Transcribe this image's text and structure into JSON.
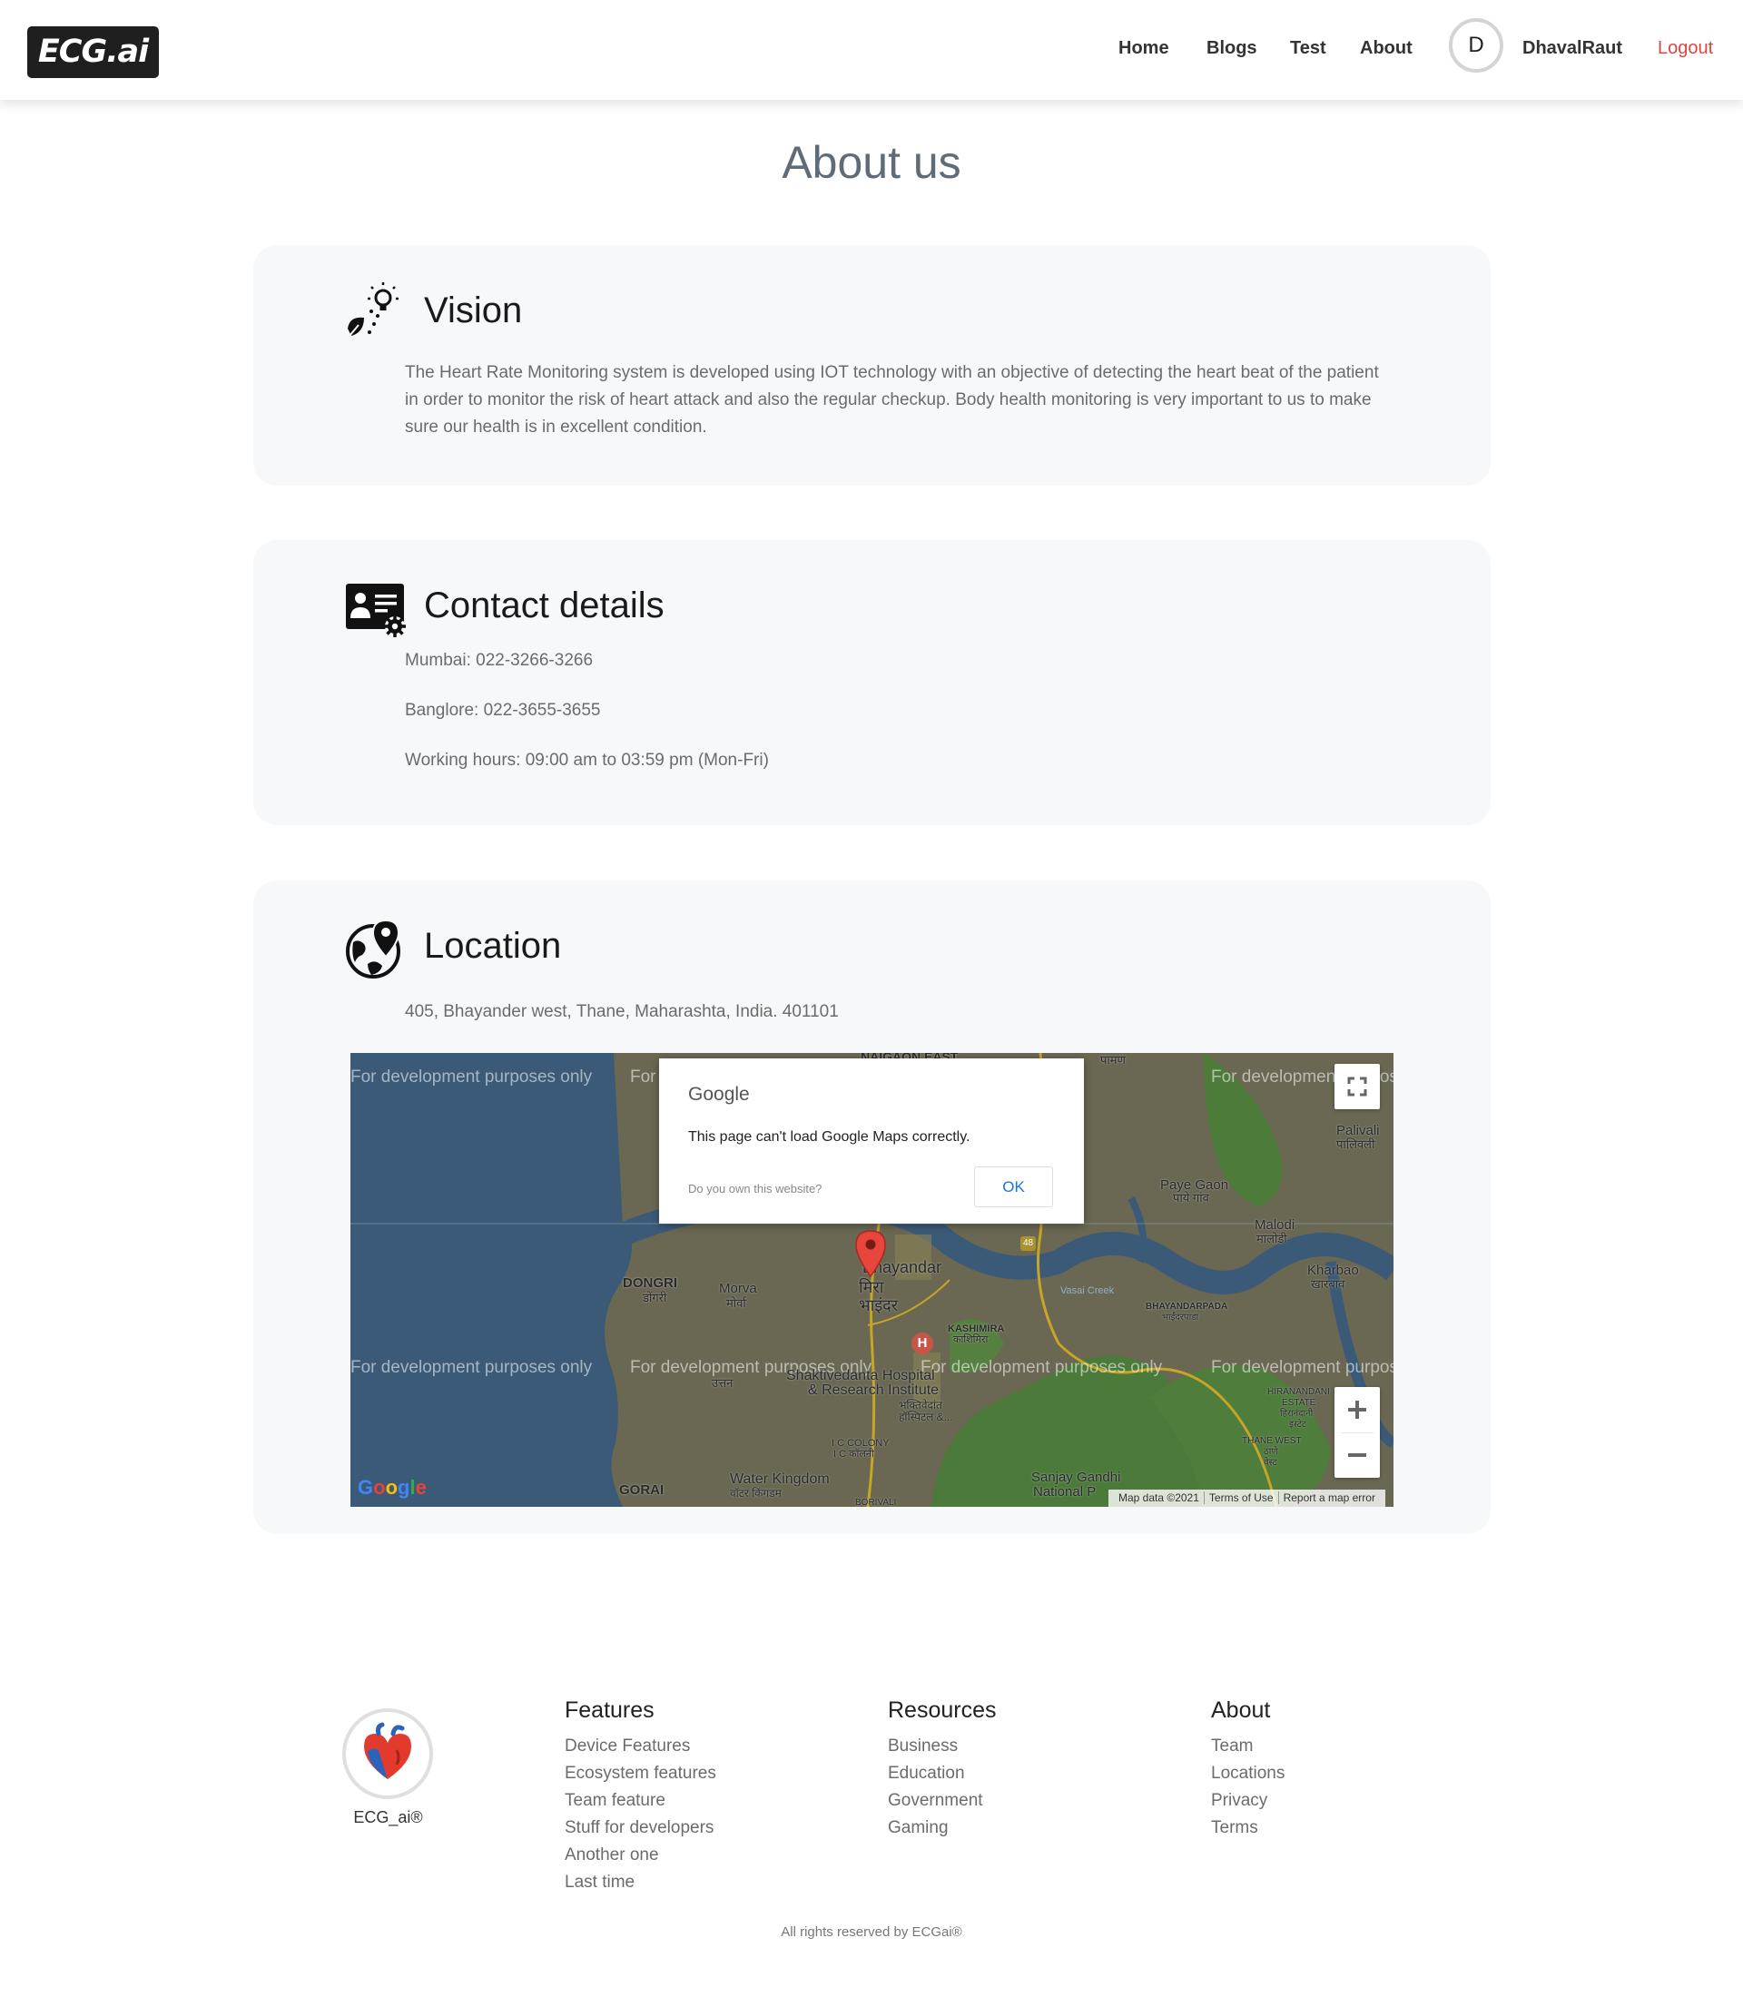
{
  "navbar": {
    "brand": "ECG.ai",
    "links": [
      "Home",
      "Blogs",
      "Test",
      "About"
    ],
    "avatar_initial": "D",
    "username": "DhavalRaut",
    "logout": "Logout"
  },
  "page": {
    "title": "About us"
  },
  "vision": {
    "title": "Vision",
    "text": "The Heart Rate Monitoring system is developed using IOT technology with an objective of detecting the heart beat of the patient in order to monitor the risk of heart attack and also the regular checkup. Body health monitoring is very important to us to make sure our health is in excellent condition."
  },
  "contact": {
    "title": "Contact details",
    "lines": [
      "Mumbai: 022-3266-3266",
      "Banglore: 022-3655-3655",
      "Working hours: 09:00 am to 03:59 pm (Mon-Fri)"
    ]
  },
  "location": {
    "title": "Location",
    "address": "405, Bhayander west, Thane, Maharashta, India. 401101",
    "map": {
      "watermark": "For development purposes only",
      "dialog": {
        "brand": "Google",
        "message": "This page can't load Google Maps correctly.",
        "own_link": "Do you own this website?",
        "ok": "OK"
      },
      "places": {
        "bhayandar": "Bhayandar",
        "bhayandar_local": "मिरा भाइंदर",
        "dongri": "DONGRI",
        "dongri_local": "डोंगरी",
        "morva": "Morva",
        "morva_local": "मोर्वा",
        "uttan_local": "उत्तन",
        "kashimira": "KASHIMIRA",
        "kashimira_local": "काशिमिरा",
        "hospital": "Shaktivedanta Hospital",
        "hospital2": "& Research Institute",
        "hospital_local": "भक्तिवेदांत",
        "hospital_local2": "हॉस्पिटल &...",
        "ic_colony": "I C COLONY",
        "ic_colony_local": "I C कॉलनी",
        "gorai": "GORAI",
        "water_kingdom": "Water Kingdom",
        "water_kingdom_local": "वॉटर किंगडम",
        "borivali": "BORIVALI",
        "sanjay": "Sanjay Gandhi",
        "national": "National P",
        "paye_gaon": "Paye Gaon",
        "paye_gaon_local": "पाये गांव",
        "malodi": "Malodi",
        "malodi_local": "मालोडी",
        "kharbao": "Kharbao",
        "kharbao_local": "खारबाव",
        "palivali": "Palivali",
        "palivali_local": "पालिवली",
        "bhayandarpada": "BHAYANDARPADA",
        "bhayandarpada_local": "भाईंदरपाडा",
        "hiranandani": "HIRANANDANI",
        "estate": "ESTATE",
        "hiranandani_local": "हिरानंदानी",
        "estate_local": "इस्टेट",
        "thane_west": "THANE WEST",
        "thane_local": "ठाणे",
        "west_local": "वेस्ट",
        "naigaon": "NAIGAON EAST",
        "paman": "पामण",
        "vasai_creek": "Vasai Creek",
        "road_48": "48",
        "hospital_marker": "H"
      },
      "logo": "Google",
      "footer": [
        "Map data ©2021",
        "Terms of Use",
        "Report a map error"
      ]
    }
  },
  "footer": {
    "brand": "ECG_ai®",
    "columns": [
      {
        "title": "Features",
        "links": [
          "Device Features",
          "Ecosystem features",
          "Team feature",
          "Stuff for developers",
          "Another one",
          "Last time"
        ]
      },
      {
        "title": "Resources",
        "links": [
          "Business",
          "Education",
          "Government",
          "Gaming"
        ]
      },
      {
        "title": "About",
        "links": [
          "Team",
          "Locations",
          "Privacy",
          "Terms"
        ]
      }
    ],
    "copyright": "All rights reserved by ECGai®"
  },
  "colors": {
    "logout": "#e0443e",
    "card_bg": "#f7f8f9",
    "title": "#5f6c78"
  },
  "icons": [
    "lightbulb-leaf-icon",
    "contact-card-gear-icon",
    "globe-pin-icon",
    "heart-icon",
    "fullscreen-icon",
    "zoom-in-icon",
    "zoom-out-icon",
    "map-pin-icon"
  ]
}
